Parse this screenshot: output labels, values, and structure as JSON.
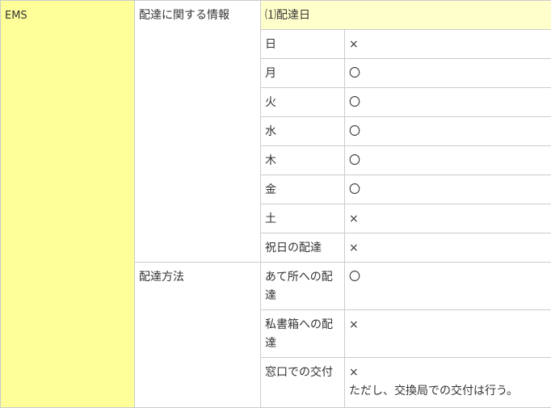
{
  "service_name": "EMS",
  "sections": [
    {
      "label": "配達に関する情報",
      "subheader": "⑴配達日",
      "rows": [
        {
          "item": "日",
          "value": "×"
        },
        {
          "item": "月",
          "value": "〇"
        },
        {
          "item": "火",
          "value": "〇"
        },
        {
          "item": "水",
          "value": "〇"
        },
        {
          "item": "木",
          "value": "〇"
        },
        {
          "item": "金",
          "value": "〇"
        },
        {
          "item": "土",
          "value": "×"
        },
        {
          "item": "祝日の配達",
          "value": "×"
        }
      ]
    },
    {
      "label": "配達方法",
      "rows": [
        {
          "item": "あて所への配達",
          "value": "〇"
        },
        {
          "item": "私書箱への配達",
          "value": "×"
        },
        {
          "item": "窓口での交付",
          "value": "×",
          "note": "ただし、交換局での交付は行う。"
        }
      ]
    }
  ]
}
